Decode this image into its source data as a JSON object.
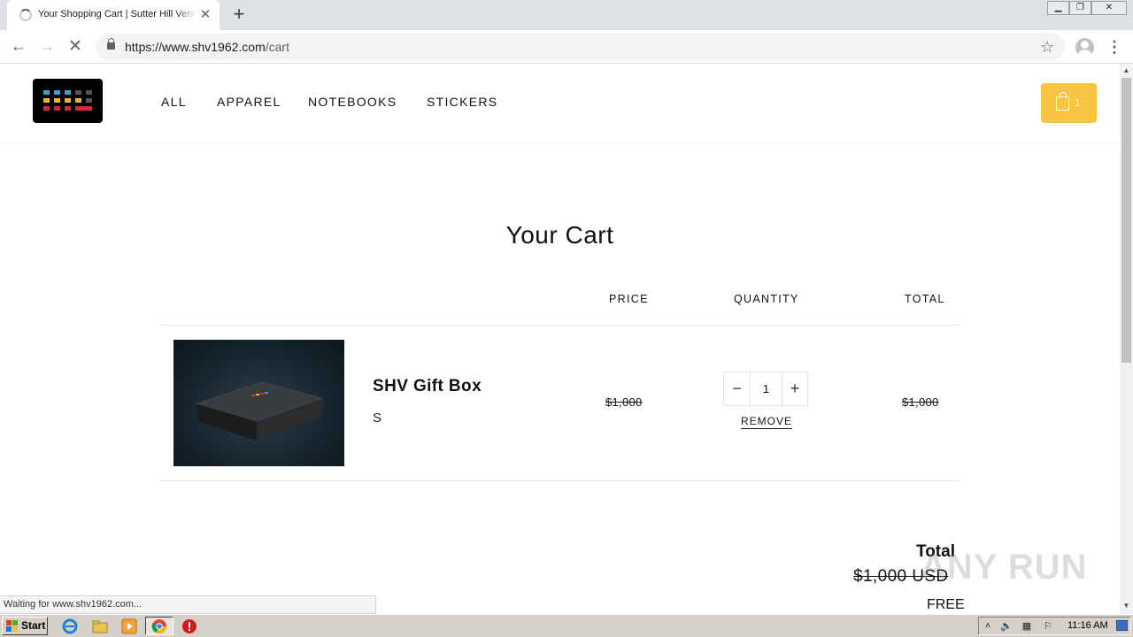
{
  "browser": {
    "tab_title": "Your Shopping Cart | Sutter Hill Ventures",
    "new_tab_symbol": "+",
    "tab_close_symbol": "✕",
    "url_host": "https://www.shv1962.com",
    "url_path": "/cart",
    "status_text": "Waiting for www.shv1962.com...",
    "icons": [
      "back-icon",
      "forward-icon",
      "stop-icon",
      "lock-icon",
      "star-icon",
      "profile-icon",
      "menu-icon"
    ]
  },
  "site": {
    "nav": [
      {
        "label": "ALL"
      },
      {
        "label": "APPAREL"
      },
      {
        "label": "NOTEBOOKS"
      },
      {
        "label": "STICKERS"
      }
    ],
    "cart_count": "1",
    "accent_color": "#f8c543"
  },
  "cart": {
    "title": "Your Cart",
    "columns": {
      "price": "PRICE",
      "quantity": "QUANTITY",
      "total": "TOTAL"
    },
    "items": [
      {
        "name": "SHV Gift Box",
        "variant": "S",
        "price": "$1,000",
        "quantity": "1",
        "remove_label": "REMOVE",
        "line_total": "$1,000"
      }
    ],
    "total_label": "Total",
    "total_original": "$1,000 USD",
    "total_final": "FREE"
  },
  "watermark": "ANY RUN",
  "taskbar": {
    "start_label": "Start",
    "clock": "11:16 AM"
  }
}
